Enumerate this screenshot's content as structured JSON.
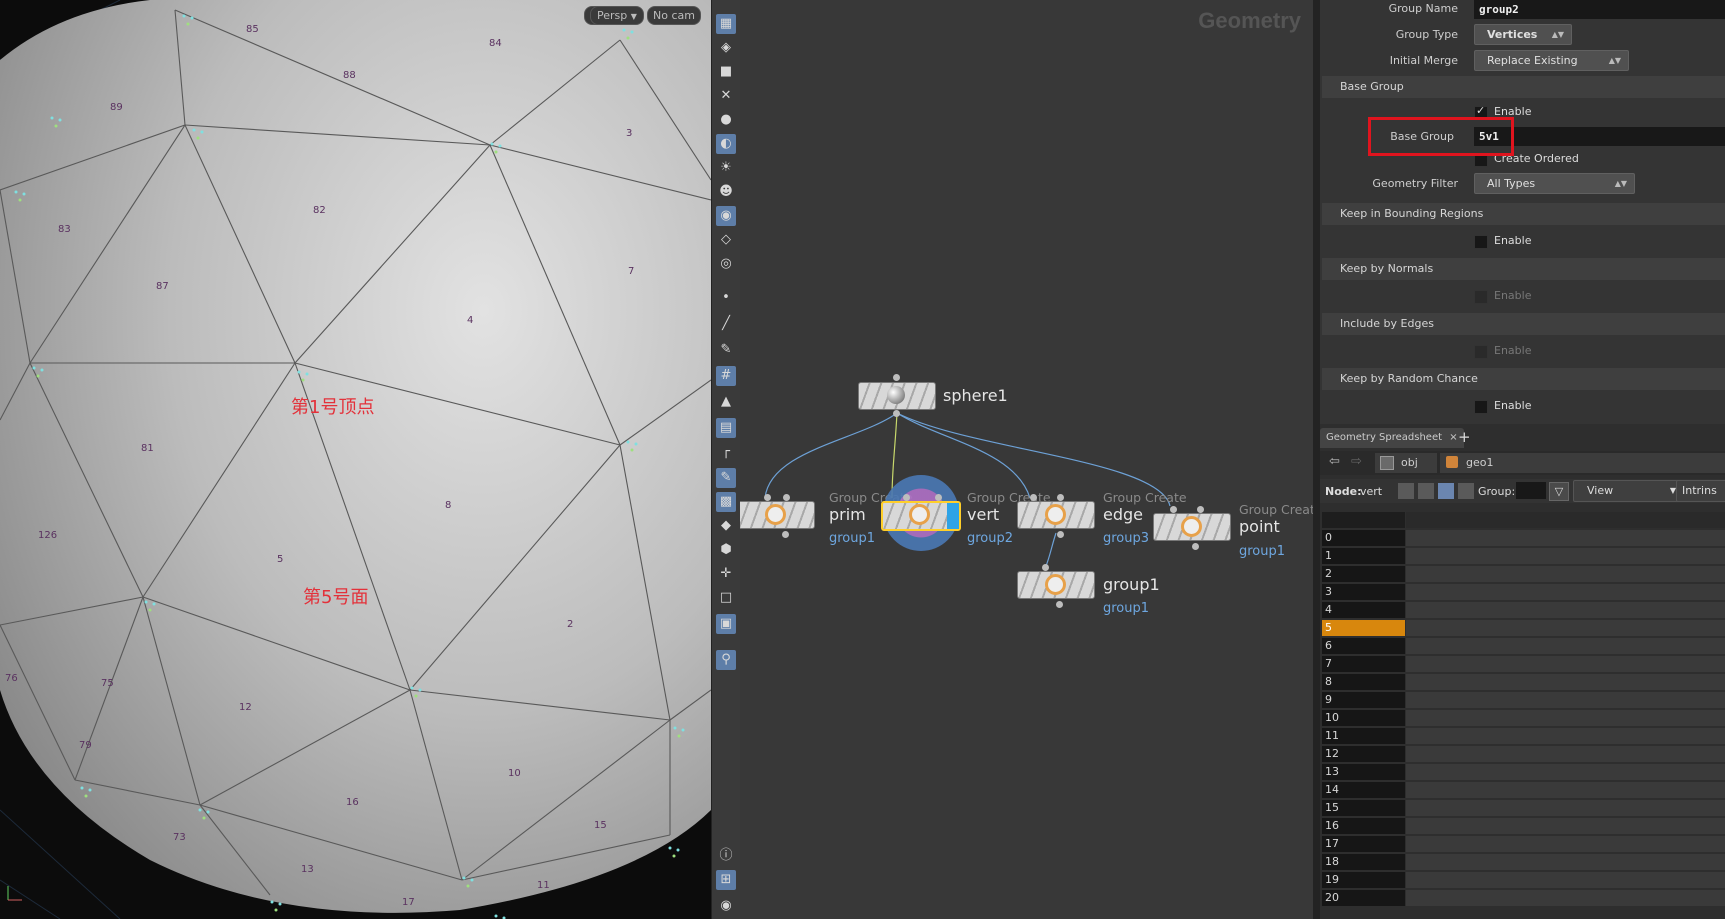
{
  "viewport": {
    "persp_label": "Persp",
    "cam_label": "No cam",
    "annotation_vertex": "第1号顶点",
    "annotation_face": "第5号面",
    "prim_numbers": [
      "85",
      "84",
      "88",
      "89",
      "3",
      "83",
      "82",
      "87",
      "7",
      "4",
      "81",
      "8",
      "126",
      "5",
      "2",
      "76",
      "75",
      "12",
      "79",
      "10",
      "16",
      "73",
      "15",
      "13",
      "17",
      "11"
    ]
  },
  "network": {
    "context_title": "Geometry",
    "nodes": [
      {
        "name": "sphere1",
        "type": "",
        "group": ""
      },
      {
        "name": "prim",
        "type": "Group Create",
        "group": "group1"
      },
      {
        "name": "vert",
        "type": "Group Create",
        "group": "group2"
      },
      {
        "name": "edge",
        "type": "Group Create",
        "group": "group3"
      },
      {
        "name": "point",
        "type": "Group Create",
        "group": "group1"
      },
      {
        "name": "group1",
        "type": "",
        "group": "group1"
      }
    ]
  },
  "params": {
    "group_name_label": "Group Name",
    "group_name_value": "group2",
    "group_type_label": "Group Type",
    "group_type_value": "Vertices",
    "initial_merge_label": "Initial Merge",
    "initial_merge_value": "Replace Existing",
    "base_group_section": "Base Group",
    "enable_label": "Enable",
    "base_group_label": "Base Group",
    "base_group_value": "5v1",
    "create_ordered_label": "Create Ordered",
    "geometry_filter_label": "Geometry Filter",
    "geometry_filter_value": "All Types",
    "bounding_section": "Keep in Bounding Regions",
    "normals_section": "Keep by Normals",
    "edges_section": "Include by Edges",
    "random_section": "Keep by Random Chance"
  },
  "sheet": {
    "tab_label": "Geometry Spreadsheet",
    "tab_close": "×",
    "add_tab": "+",
    "path_obj": "obj",
    "path_geo": "geo1",
    "node_label": "Node:",
    "node_value": "vert",
    "group_label": "Group:",
    "view_label": "View",
    "intrinsics_label": "Intrins",
    "rows": [
      "0",
      "1",
      "2",
      "3",
      "4",
      "5",
      "6",
      "7",
      "8",
      "9",
      "10",
      "11",
      "12",
      "13",
      "14",
      "15",
      "16",
      "17",
      "18",
      "19",
      "20"
    ],
    "selected_row": "5"
  },
  "colors": {
    "selection": "#d8870d",
    "highlight_box": "#e0141e",
    "annotation": "#e3313a",
    "group_link": "#6ea7e0"
  }
}
